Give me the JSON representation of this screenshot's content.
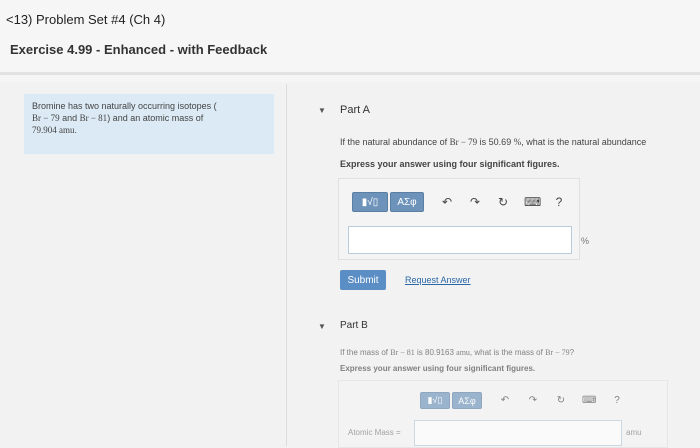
{
  "header": {
    "back_label": "<13) Problem Set #4 (Ch 4)",
    "exercise_title": "Exercise 4.99 - Enhanced - with Feedback"
  },
  "problem": {
    "text_1": "Bromine has two naturally occurring isotopes (",
    "iso1": "Br − 79",
    "and": " and ",
    "iso2": "Br − 81",
    "text_2": ") and an atomic mass of",
    "mass": "79.904 amu",
    "text_3": "."
  },
  "part_a": {
    "title": "Part A",
    "q_pre": "If the natural abundance of ",
    "q_iso": "Br − 79",
    "q_mid": " is 50.69 ",
    "q_pct": "%",
    "q_post": ", what is the natural abundance",
    "instruction": "Express your answer using four significant figures.",
    "unit": "%",
    "submit_label": "Submit",
    "request_label": "Request Answer"
  },
  "part_b": {
    "title": "Part B",
    "q_pre": "If the mass of ",
    "q_iso": "Br − 81",
    "q_mid": " is 80.9163 ",
    "q_amu": "amu",
    "q_post": ", what is the mass of ",
    "q_iso2": "Br − 79",
    "q_end": "?",
    "instruction": "Express your answer using four significant figures.",
    "input_label": "Atomic Mass =",
    "unit": "amu"
  },
  "toolbar": {
    "template_label": "▮√▯",
    "greek_label": "ΑΣφ",
    "help_label": "?",
    "icons": [
      "undo-icon",
      "redo-icon",
      "reset-icon",
      "keyboard-icon",
      "help-icon"
    ]
  },
  "colors": {
    "accent": "#5b8ec4",
    "toolbar_button": "#6d93ba",
    "problem_bg": "#dbeaf4",
    "link": "#2a68a8"
  }
}
